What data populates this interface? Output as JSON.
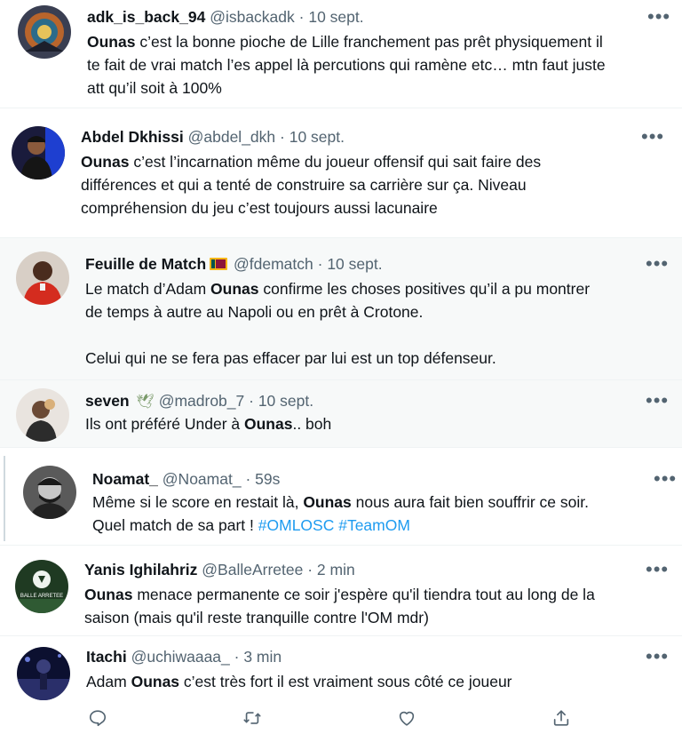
{
  "tweets": [
    {
      "display_name": "adk_is_back_94",
      "handle": "@isbackadk",
      "date": "10 sept.",
      "lines": [
        [
          {
            "b": "Ounas"
          },
          {
            "t": " c’est la bonne pioche de Lille franchement pas prêt physiquement il"
          }
        ],
        [
          {
            "t": "te fait de vrai match l’es appel là percutions qui ramène etc… mtn faut juste"
          }
        ],
        [
          {
            "t": "att qu’il soit à 100%"
          }
        ]
      ]
    },
    {
      "display_name": "Abdel Dkhissi",
      "handle": "@abdel_dkh",
      "date": "10 sept.",
      "lines": [
        [
          {
            "b": "Ounas"
          },
          {
            "t": " c’est l’incarnation même du joueur offensif qui sait faire des"
          }
        ],
        [
          {
            "t": "différences et qui a tenté de construire sa carrière sur ça. Niveau"
          }
        ],
        [
          {
            "t": "compréhension du jeu c’est toujours aussi lacunaire"
          }
        ]
      ]
    },
    {
      "display_name": "Feuille de Match",
      "flag": "sri-lanka-flag",
      "handle": "@fdematch",
      "date": "10 sept.",
      "lines": [
        [
          {
            "t": "Le match d’Adam "
          },
          {
            "b": "Ounas"
          },
          {
            "t": " confirme les choses positives qu’il a pu montrer"
          }
        ],
        [
          {
            "t": "de temps à autre au Napoli ou en prêt à Crotone."
          }
        ],
        [
          {
            "t": ""
          }
        ],
        [
          {
            "t": "Celui qui ne se fera pas effacer par lui est un top défenseur."
          }
        ]
      ]
    },
    {
      "display_name": "seven",
      "emoji": "🕊",
      "handle": "@madrob_7",
      "date": "10 sept.",
      "lines": [
        [
          {
            "t": "Ils ont préféré Under à "
          },
          {
            "b": "Ounas"
          },
          {
            "t": ".. boh"
          }
        ]
      ]
    },
    {
      "display_name": "Noamat_",
      "handle": "@Noamat_",
      "date": "59s",
      "lines": [
        [
          {
            "t": "Même si le score en restait là, "
          },
          {
            "b": "Ounas"
          },
          {
            "t": " nous aura fait bien souffrir ce soir."
          }
        ],
        [
          {
            "t": "Quel match de sa part ! "
          },
          {
            "h": "#OMLOSC #TeamOM"
          }
        ]
      ]
    },
    {
      "display_name": "Yanis Ighilahriz",
      "handle": "@BalleArretee",
      "date": "2 min",
      "avatar_text": "BALLE ARRETEE",
      "lines": [
        [
          {
            "b": "Ounas"
          },
          {
            "t": " menace permanente ce soir j'espère qu'il tiendra tout au long de la"
          }
        ],
        [
          {
            "t": "saison (mais qu'il reste tranquille contre l'OM mdr)"
          }
        ]
      ]
    },
    {
      "display_name": "Itachi",
      "handle": "@uchiwaaaa_",
      "date": "3 min",
      "lines": [
        [
          {
            "t": "Adam "
          },
          {
            "b": "Ounas"
          },
          {
            "t": " c’est très fort il est vraiment sous côté ce joueur"
          }
        ]
      ]
    }
  ],
  "separator": " · ",
  "more_label": "•••",
  "action_icons": [
    "reply-icon",
    "retweet-icon",
    "like-icon",
    "share-icon"
  ],
  "colors": {
    "text": "#0f1419",
    "meta": "#536471",
    "link": "#1d9bf0",
    "highlight_bg": "#f7f9f9"
  }
}
